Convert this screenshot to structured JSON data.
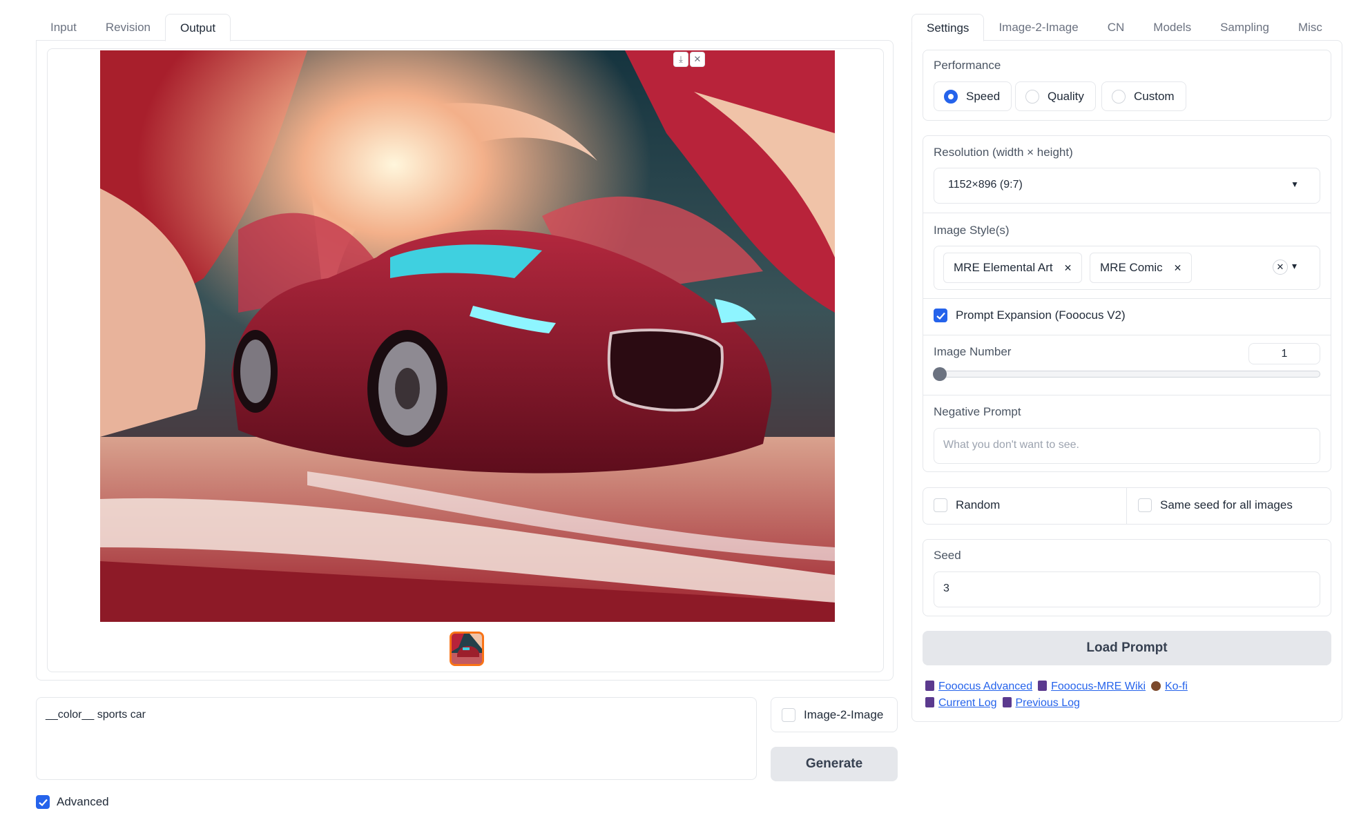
{
  "left_tabs": [
    "Input",
    "Revision",
    "Output"
  ],
  "left_active_tab": "Output",
  "gallery": {
    "download_icon": "download-icon",
    "close_icon": "close-icon",
    "download_glyph": "⤓",
    "close_glyph": "✕"
  },
  "prompt": {
    "value": "__color__ sports car"
  },
  "img2img_label": "Image-2-Image",
  "generate_label": "Generate",
  "advanced_label": "Advanced",
  "right_tabs": [
    "Settings",
    "Image-2-Image",
    "CN",
    "Models",
    "Sampling",
    "Misc"
  ],
  "right_active_tab": "Settings",
  "performance": {
    "label": "Performance",
    "options": [
      "Speed",
      "Quality",
      "Custom"
    ],
    "selected": "Speed"
  },
  "resolution": {
    "label": "Resolution (width × height)",
    "value": "1152×896 (9:7)",
    "arrow": "▼"
  },
  "styles": {
    "label": "Image Style(s)",
    "selected": [
      "MRE Elemental Art",
      "MRE Comic"
    ],
    "remove_glyph": "✕",
    "clear_glyph": "✕",
    "dropdown_glyph": "▾"
  },
  "prompt_expansion": {
    "label": "Prompt Expansion (Fooocus V2)",
    "checked": true
  },
  "image_number": {
    "label": "Image Number",
    "value": "1",
    "fraction": 0.0
  },
  "negative_prompt": {
    "label": "Negative Prompt",
    "placeholder": "What you don't want to see."
  },
  "random": {
    "label": "Random",
    "checked": false
  },
  "same_seed": {
    "label": "Same seed for all images",
    "checked": false
  },
  "seed": {
    "label": "Seed",
    "value": "3"
  },
  "load_prompt_label": "Load Prompt",
  "links_row1": [
    "Fooocus Advanced",
    "Fooocus-MRE Wiki",
    "Ko-fi"
  ],
  "links_row2": [
    "Current Log",
    "Previous Log"
  ],
  "colors": {
    "accent": "#2563eb",
    "border": "#e5e7eb",
    "thumb_border": "#f97316"
  }
}
